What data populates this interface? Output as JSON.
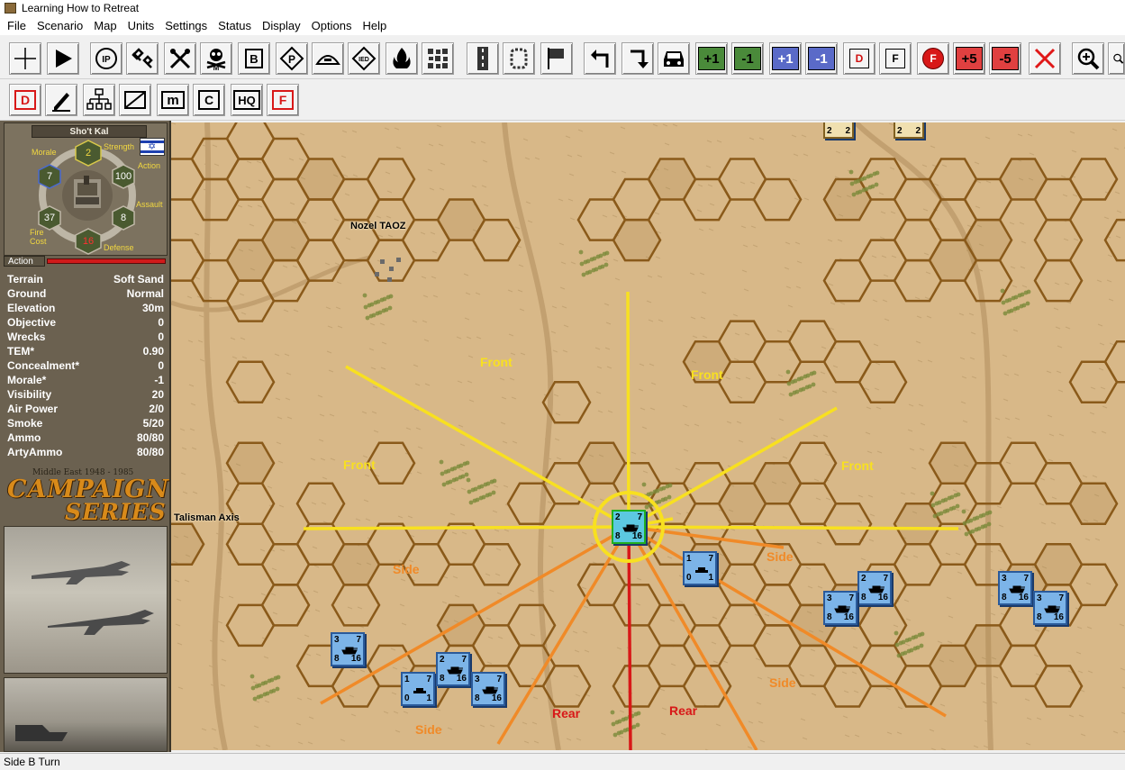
{
  "window": {
    "title": "Learning How to Retreat"
  },
  "menu": [
    "File",
    "Scenario",
    "Map",
    "Units",
    "Settings",
    "Status",
    "Display",
    "Options",
    "Help"
  ],
  "toolbar": {
    "row1": [
      {
        "name": "select-tool-button",
        "icon": "crosshair-icon"
      },
      {
        "name": "move-button",
        "icon": "play-icon"
      },
      {
        "name": "ip-button",
        "icon": "ip-icon",
        "label": "IP"
      },
      {
        "name": "engineer-button",
        "icon": "engineer-icon"
      },
      {
        "name": "clear-mines-button",
        "icon": "tools-icon"
      },
      {
        "name": "minefield-button",
        "icon": "skull-icon",
        "label": "M"
      },
      {
        "name": "bridge-button",
        "icon": "bridge-icon",
        "label": "B"
      },
      {
        "name": "parking-button",
        "icon": "p-icon",
        "label": "P"
      },
      {
        "name": "bunker-button",
        "icon": "bunker-icon"
      },
      {
        "name": "ied-button",
        "icon": "ied-icon",
        "label": "IED"
      },
      {
        "name": "fire-button",
        "icon": "fire-icon"
      },
      {
        "name": "rubble-button",
        "icon": "rubble-icon"
      },
      {
        "name": "road-button",
        "icon": "road-icon"
      },
      {
        "name": "smoke-button",
        "icon": "smoke-icon"
      },
      {
        "name": "flag-button",
        "icon": "flag-icon"
      },
      {
        "name": "turn-left-button",
        "icon": "turn-left-icon"
      },
      {
        "name": "turn-right-button",
        "icon": "turn-right-icon"
      },
      {
        "name": "vehicle-button",
        "icon": "car-icon"
      },
      {
        "name": "plus-one-green-button",
        "label": "+1",
        "color": "#4a8a3a"
      },
      {
        "name": "minus-one-green-button",
        "label": "-1",
        "color": "#4a8a3a"
      },
      {
        "name": "plus-one-blue-button",
        "label": "+1",
        "color": "#5a6ac8"
      },
      {
        "name": "minus-one-blue-button",
        "label": "-1",
        "color": "#5a6ac8"
      },
      {
        "name": "d-button",
        "label": "D"
      },
      {
        "name": "f-button",
        "label": "F"
      },
      {
        "name": "f-red-button",
        "label": "F"
      },
      {
        "name": "plus-five-button",
        "label": "+5",
        "color": "#e04040"
      },
      {
        "name": "minus-five-button",
        "label": "-5",
        "color": "#e04040"
      },
      {
        "name": "cancel-button",
        "icon": "close-icon"
      },
      {
        "name": "zoom-in-button",
        "icon": "zoom-in-icon"
      },
      {
        "name": "zoom-out-button",
        "icon": "zoom-out-icon"
      }
    ],
    "row2": [
      {
        "name": "d-red-button",
        "label": "D"
      },
      {
        "name": "draw-button",
        "icon": "pen-icon"
      },
      {
        "name": "org-chart-button",
        "icon": "org-chart-icon"
      },
      {
        "name": "line-button",
        "icon": "slash-icon"
      },
      {
        "name": "m-box-button",
        "label": "m"
      },
      {
        "name": "c-button",
        "label": "C"
      },
      {
        "name": "hq-button",
        "label": "HQ"
      },
      {
        "name": "f-box-button",
        "label": "F"
      }
    ]
  },
  "unit": {
    "name": "Sho't Kal",
    "flag": "israel-flag-icon",
    "labels": {
      "strength": "Strength",
      "morale": "Morale",
      "action": "Action",
      "assault": "Assault",
      "fire_cost": "Fire\nCost",
      "defense": "Defense"
    },
    "values": {
      "strength": "2",
      "morale": "7",
      "action": "100",
      "assault": "8",
      "fire_cost": "37",
      "defense": "16"
    },
    "action_bar_label": "Action"
  },
  "hex_info": [
    {
      "label": "Terrain",
      "value": "Soft Sand"
    },
    {
      "label": "Ground",
      "value": "Normal"
    },
    {
      "label": "Elevation",
      "value": "30m"
    },
    {
      "label": "Objective",
      "value": "0"
    },
    {
      "label": "Wrecks",
      "value": "0"
    },
    {
      "label": "TEM*",
      "value": "0.90"
    },
    {
      "label": "Concealment*",
      "value": "0"
    },
    {
      "label": "Morale*",
      "value": "-1"
    },
    {
      "label": "Visibility",
      "value": "20"
    },
    {
      "label": "Air Power",
      "value": "2/0"
    },
    {
      "label": "Smoke",
      "value": "5/20"
    },
    {
      "label": "Ammo",
      "value": "80/80"
    },
    {
      "label": "ArtyAmmo",
      "value": "80/80"
    }
  ],
  "logo": {
    "subtitle": "Middle East 1948 - 1985",
    "line1": "CAMPAIGN",
    "line2": "SERIES"
  },
  "map": {
    "place_labels": [
      "Nozel TAOZ",
      "Talisman Axis"
    ],
    "arc_labels": {
      "front": "Front",
      "side": "Side",
      "rear": "Rear"
    },
    "colors": {
      "front": "#f8e020",
      "side": "#f08a28",
      "rear": "#d81818",
      "hex": "#8a5a1a",
      "sand": "#d8b888"
    },
    "counters": [
      {
        "tl": "2",
        "tr": "7",
        "bl": "8",
        "br": "16"
      },
      {
        "tl": "1",
        "tr": "7",
        "bl": "0",
        "br": "1"
      },
      {
        "tl": "2",
        "tr": "7",
        "bl": "8",
        "br": "16"
      },
      {
        "tl": "3",
        "tr": "7",
        "bl": "8",
        "br": "16"
      },
      {
        "tl": "3",
        "tr": "7",
        "bl": "8",
        "br": "16"
      },
      {
        "tl": "3",
        "tr": "7",
        "bl": "8",
        "br": "16"
      },
      {
        "tl": "3",
        "tr": "7",
        "bl": "8",
        "br": "16"
      },
      {
        "tl": "1",
        "tr": "7",
        "bl": "0",
        "br": "1"
      },
      {
        "tl": "2",
        "tr": "7",
        "bl": "8",
        "br": "16"
      },
      {
        "tl": "3",
        "tr": "7",
        "bl": "8",
        "br": "16"
      }
    ],
    "top_counters": [
      {
        "tl": "2",
        "tr": "2"
      },
      {
        "tl": "2",
        "tr": "2"
      }
    ]
  },
  "status": {
    "text": "Side B Turn"
  }
}
